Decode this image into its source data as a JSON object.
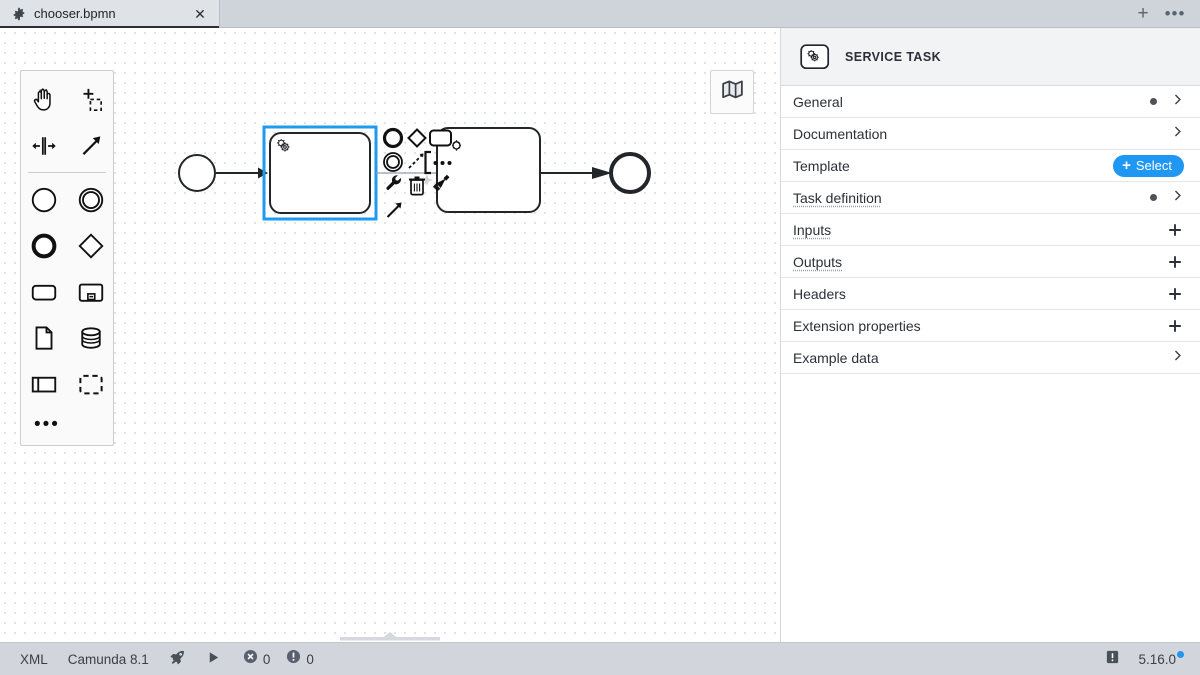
{
  "window": {
    "tab": {
      "title": "chooser.bpmn",
      "icon": "gear-icon",
      "close_label": "✕"
    },
    "actions": {
      "new_tab_label": "+",
      "overflow_label": "•••"
    }
  },
  "palette": {
    "tools": [
      {
        "name": "hand-tool",
        "title": "Activate the hand tool"
      },
      {
        "name": "lasso-tool",
        "title": "Activate the lasso tool"
      },
      {
        "name": "space-tool",
        "title": "Activate the create/remove space tool"
      },
      {
        "name": "global-connect-tool",
        "title": "Activate the global connect tool"
      }
    ],
    "elements": [
      {
        "name": "create-start-event",
        "title": "Create StartEvent"
      },
      {
        "name": "create-intermediate-event",
        "title": "Create Intermediate/Boundary Event"
      },
      {
        "name": "create-end-event",
        "title": "Create EndEvent"
      },
      {
        "name": "create-gateway",
        "title": "Create Gateway"
      },
      {
        "name": "create-task",
        "title": "Create Task"
      },
      {
        "name": "create-subprocess-expanded",
        "title": "Create expanded SubProcess"
      },
      {
        "name": "create-data-object",
        "title": "Create DataObjectReference"
      },
      {
        "name": "create-data-store",
        "title": "Create DataStoreReference"
      },
      {
        "name": "create-participant",
        "title": "Create Pool/Participant"
      },
      {
        "name": "create-group",
        "title": "Create Group"
      }
    ],
    "more_label": "•••"
  },
  "canvas": {
    "minimap_icon": "map-icon",
    "minimap_title": "Toggle minimap",
    "drawer_handle": "canvas-drawer-handle",
    "elements": [
      {
        "name": "start-event",
        "type": "startEvent",
        "label": ""
      },
      {
        "name": "service-task-selected",
        "type": "serviceTask",
        "label": "",
        "selected": true,
        "marker": "gears-icon"
      },
      {
        "name": "task",
        "type": "task",
        "label": ""
      },
      {
        "name": "end-event",
        "type": "endEvent",
        "label": ""
      }
    ],
    "context_pad": [
      {
        "name": "append-end-event",
        "title": "Append EndEvent"
      },
      {
        "name": "append-gateway",
        "title": "Append Gateway"
      },
      {
        "name": "append-task",
        "title": "Append Task"
      },
      {
        "name": "change-element",
        "title": "Change element"
      },
      {
        "name": "append-intermediate-event",
        "title": "Append Intermediate/Boundary Event"
      },
      {
        "name": "connect",
        "title": "Connect using Sequence/MessageFlow or Association"
      },
      {
        "name": "append-text-annotation",
        "title": "Append TextAnnotation"
      },
      {
        "name": "more-options",
        "title": "More options"
      },
      {
        "name": "wrench",
        "title": "Open wrench menu"
      },
      {
        "name": "delete",
        "title": "Remove"
      },
      {
        "name": "set-color",
        "title": "Set color"
      },
      {
        "name": "connect-arrow",
        "title": "Connect"
      }
    ]
  },
  "properties": {
    "header": {
      "icon": "service-task-icon",
      "title": "SERVICE TASK"
    },
    "groups": [
      {
        "label": "General",
        "control": "chevron",
        "dot": true,
        "dotted": false
      },
      {
        "label": "Documentation",
        "control": "chevron",
        "dot": false,
        "dotted": false
      },
      {
        "label": "Template",
        "control": "select",
        "dot": false,
        "dotted": false,
        "button_label": "Select",
        "button_plus": "+"
      },
      {
        "label": "Task definition",
        "control": "chevron",
        "dot": true,
        "dotted": true
      },
      {
        "label": "Inputs",
        "control": "plus",
        "dot": false,
        "dotted": true
      },
      {
        "label": "Outputs",
        "control": "plus",
        "dot": false,
        "dotted": true
      },
      {
        "label": "Headers",
        "control": "plus",
        "dot": false,
        "dotted": false
      },
      {
        "label": "Extension properties",
        "control": "plus",
        "dot": false,
        "dotted": false
      },
      {
        "label": "Example data",
        "control": "chevron",
        "dot": false,
        "dotted": false
      }
    ]
  },
  "statusbar": {
    "xml_label": "XML",
    "engine_label": "Camunda 8.1",
    "deploy_icon": "rocket-icon",
    "run_icon": "play-icon",
    "errors": {
      "icon": "error-icon",
      "count": "0"
    },
    "warnings": {
      "icon": "warning-icon",
      "count": "0"
    },
    "note_icon": "log-icon",
    "version": "5.16.0"
  },
  "colors": {
    "accent": "#1f97f3",
    "selection": "#1e9bf0",
    "tabbar_bg": "#ced4da",
    "tab_active_bg": "#dfe3e8",
    "statusbar_bg": "#d2d6dc",
    "panel_header_bg": "#f2f3f5",
    "stroke": "#22252a"
  }
}
